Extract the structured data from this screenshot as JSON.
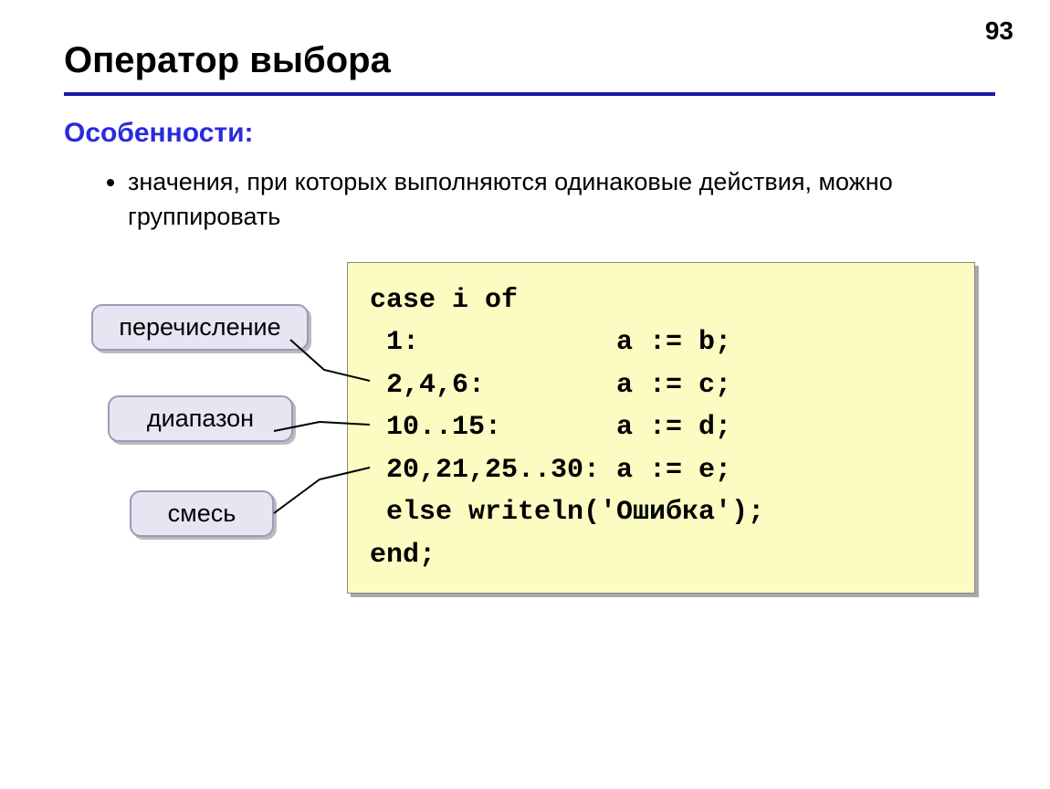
{
  "page_number": "93",
  "title": "Оператор выбора",
  "subheading": "Особенности:",
  "bullet": "значения, при которых выполняются одинаковые действия, можно группировать",
  "callouts": {
    "enumeration": "перечисление",
    "range": "диапазон",
    "mix": "смесь"
  },
  "code": "case i of\n 1:            a := b;\n 2,4,6:        a := c;\n 10..15:       a := d;\n 20,21,25..30: a := e;\n else writeln('Ошибка');\nend;"
}
